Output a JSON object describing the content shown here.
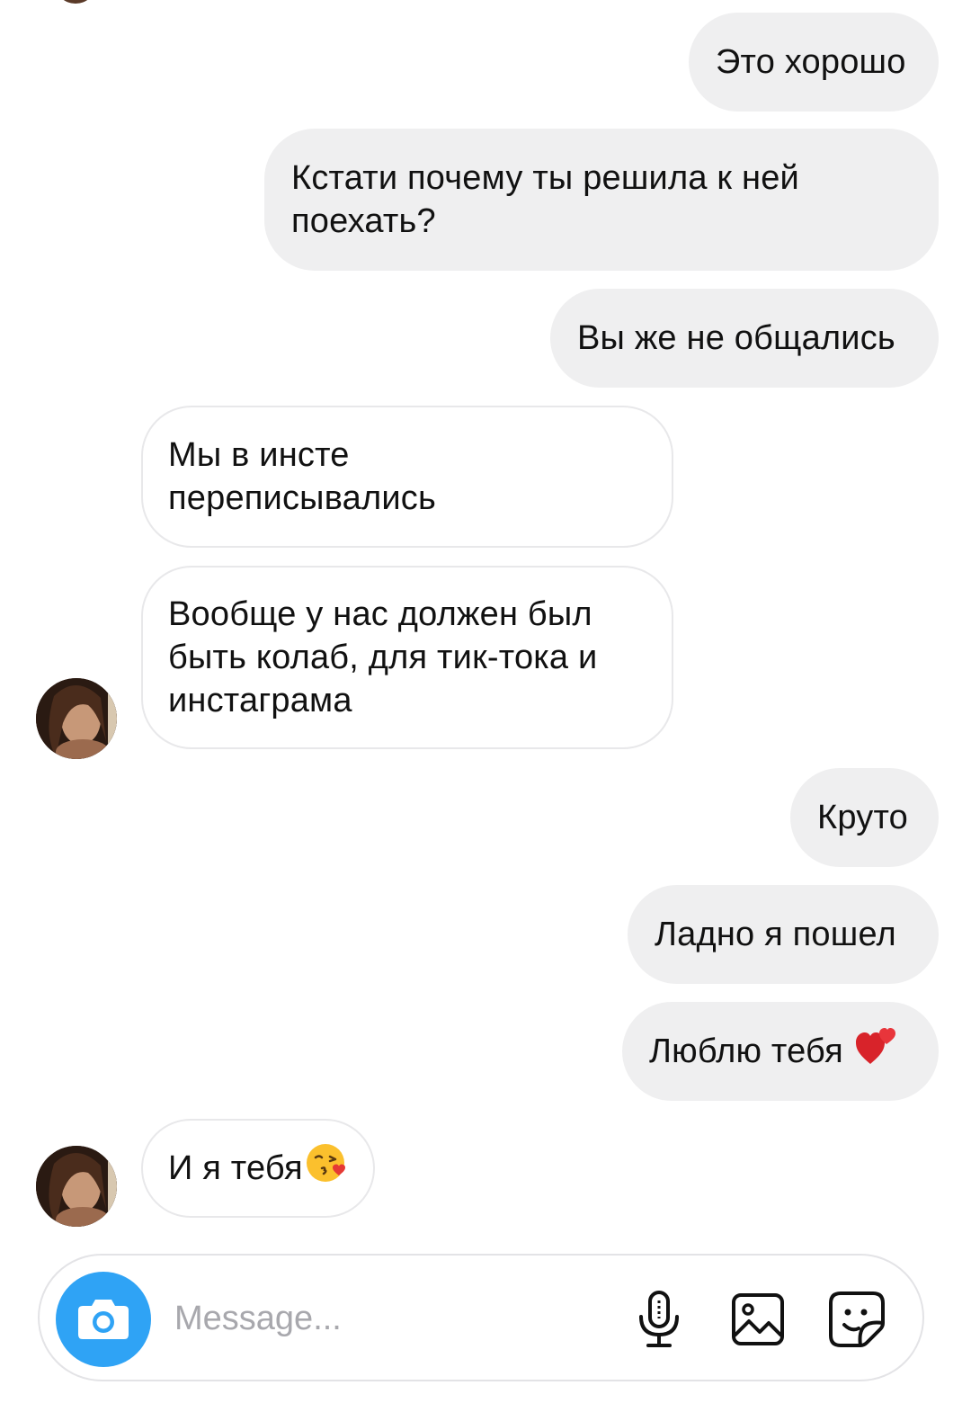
{
  "messages": [
    {
      "direction": "out",
      "text": "Это хорошо"
    },
    {
      "direction": "out",
      "text": "Кстати почему ты решила к ней поехать?"
    },
    {
      "direction": "out",
      "text": "Вы же не общались"
    },
    {
      "direction": "in",
      "text": "Мы в инсте переписывались"
    },
    {
      "direction": "in",
      "text": "Вообще у нас должен был быть колаб, для тик-тока и инстаграма"
    },
    {
      "direction": "out",
      "text": "Круто"
    },
    {
      "direction": "out",
      "text": "Ладно я пошел"
    },
    {
      "direction": "out",
      "text": "Люблю тебя",
      "emoji": "two-hearts-icon"
    },
    {
      "direction": "in",
      "text": "И я тебя",
      "emoji": "kissing-face-heart-icon"
    }
  ],
  "composer": {
    "placeholder": "Message...",
    "icons": [
      "camera-icon",
      "microphone-icon",
      "gallery-icon",
      "sticker-icon"
    ],
    "accent": "#2fa3f5"
  },
  "colors": {
    "outgoing_bubble": "#efeff0",
    "incoming_border": "#e8e8ea",
    "text": "#111111",
    "placeholder": "#a8a8ad"
  }
}
